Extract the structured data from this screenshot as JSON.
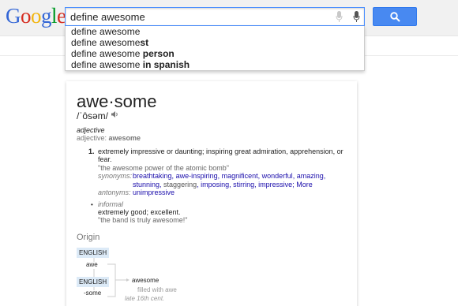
{
  "header": {
    "logo_letters": [
      {
        "ch": "G",
        "color": "#3366d6"
      },
      {
        "ch": "o",
        "color": "#d62d20"
      },
      {
        "ch": "o",
        "color": "#f2b50f"
      },
      {
        "ch": "g",
        "color": "#3366d6"
      },
      {
        "ch": "l",
        "color": "#009925"
      },
      {
        "ch": "e",
        "color": "#d62d20"
      }
    ],
    "search_value": "define awesome",
    "search_button_color": "#4889f1"
  },
  "suggestions": [
    {
      "plain": "define awesome",
      "bold": ""
    },
    {
      "plain": "define awesome",
      "bold": "st"
    },
    {
      "plain": "define awesome ",
      "bold": "person"
    },
    {
      "plain": "define awesome ",
      "bold": "in spanish"
    }
  ],
  "definition": {
    "word": "awe·some",
    "pronunciation": "/ˈôsəm/",
    "part_of_speech": "adjective",
    "forms_label": "adjective: ",
    "forms_value": "awesome",
    "sense1": {
      "number": "1.",
      "text": "extremely impressive or daunting; inspiring great admiration, apprehension, or fear.",
      "example": "\"the awesome power of the atomic bomb\"",
      "synonyms_label": "synonyms:",
      "synonyms": [
        "breathtaking",
        "awe-inspiring",
        "magnificent",
        "wonderful",
        "amazing",
        "stunning"
      ],
      "synonyms_plain": "staggering",
      "synonyms_more": [
        "imposing",
        "stirring",
        "impressive"
      ],
      "more_label": "More",
      "antonyms_label": "antonyms:",
      "antonyms": "unimpressive"
    },
    "sense2": {
      "label": "informal",
      "text": "extremely good; excellent.",
      "example": "\"the band is truly awesome!\""
    }
  },
  "origin": {
    "title": "Origin",
    "tag1": "ENGLISH",
    "morph1": "awe",
    "tag2": "ENGLISH",
    "morph2": "-some",
    "result": "awesome",
    "gloss": "filled with awe",
    "date": "late 16th cent."
  }
}
